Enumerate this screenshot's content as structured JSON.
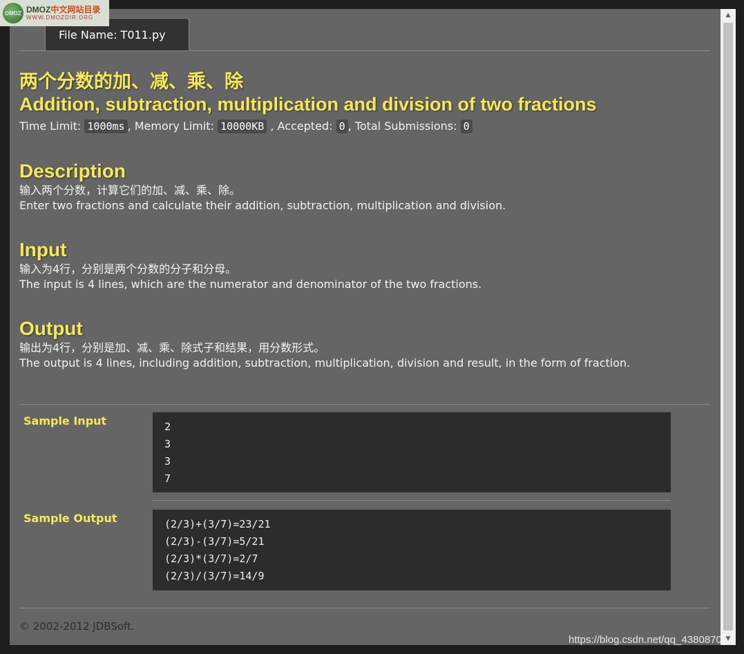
{
  "watermark": {
    "logo_badge": "DMOZ",
    "logo_brand": "DMOZ",
    "logo_cn": "中文网站目录",
    "logo_url": "WWW.DMOZDIR.ORG",
    "csdn_url": "https://blog.csdn.net/qq_4380870"
  },
  "tab": {
    "label": "File Name:  T011.py"
  },
  "problem": {
    "title_cn": "两个分数的加、减、乘、除",
    "title_en": "Addition, subtraction, multiplication and division of two fractions",
    "limits": {
      "time_label": "Time Limit:",
      "time_value": "1000ms",
      "memory_label": ", Memory Limit:",
      "memory_value": "10000KB",
      "accepted_label": ", Accepted:",
      "accepted_value": "0",
      "submissions_label": ", Total Submissions:",
      "submissions_value": "0"
    },
    "description": {
      "heading": "Description",
      "cn": "输入两个分数，计算它们的加、减、乘、除。",
      "en": "Enter two fractions and calculate their addition, subtraction, multiplication and division."
    },
    "input": {
      "heading": "Input",
      "cn": "输入为4行，分别是两个分数的分子和分母。",
      "en": "The input is 4 lines, which are the numerator and denominator of the two fractions."
    },
    "output": {
      "heading": "Output",
      "cn": "输出为4行，分别是加、减、乘、除式子和结果，用分数形式。",
      "en": "The output is 4 lines, including addition, subtraction, multiplication, division and result, in the form of fraction."
    }
  },
  "samples": {
    "input_label": "Sample Input",
    "input_lines": [
      "2",
      "3",
      "3",
      "7"
    ],
    "output_label": "Sample Output",
    "output_lines": [
      "(2/3)+(3/7)=23/21",
      "(2/3)-(3/7)=5/21",
      "(2/3)*(3/7)=2/7",
      "(2/3)/(3/7)=14/9"
    ]
  },
  "footer": {
    "copyright": "© 2002-2012  JDBSoft."
  }
}
